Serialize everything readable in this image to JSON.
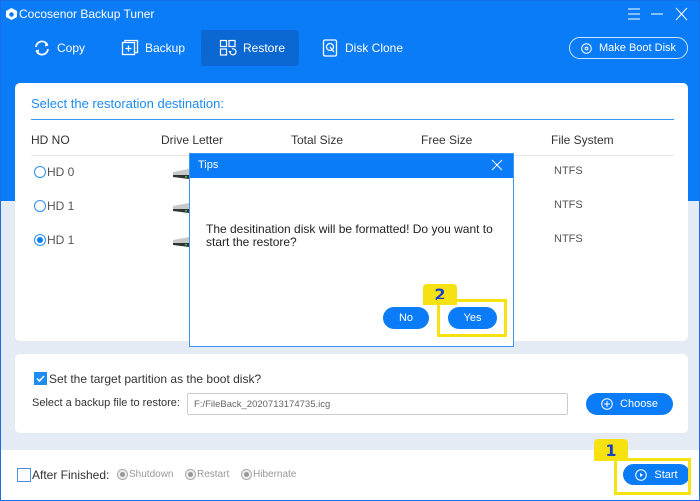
{
  "app": {
    "title": "Cocosenor Backup Tuner",
    "window_controls": [
      "menu",
      "minimize",
      "close"
    ]
  },
  "nav": {
    "items": [
      {
        "label": "Copy",
        "icon": "sync-icon",
        "active": false
      },
      {
        "label": "Backup",
        "icon": "backup-icon",
        "active": false
      },
      {
        "label": "Restore",
        "icon": "restore-icon",
        "active": true
      },
      {
        "label": "Disk Clone",
        "icon": "disk-clone-icon",
        "active": false
      }
    ],
    "make_boot_disk_label": "Make Boot Disk"
  },
  "destination": {
    "title": "Select the restoration destination:",
    "columns": [
      "HD NO",
      "Drive Letter",
      "Total Size",
      "Free Size",
      "File System"
    ],
    "rows": [
      {
        "hd": "HD 0",
        "drive_letter": "",
        "total_size": "",
        "free_size": "",
        "file_system": "NTFS",
        "selected": false
      },
      {
        "hd": "HD 1",
        "drive_letter": "",
        "total_size": "",
        "free_size": "",
        "file_system": "NTFS",
        "selected": false
      },
      {
        "hd": "HD 1",
        "drive_letter": "",
        "total_size": "",
        "free_size": "",
        "file_system": "NTFS",
        "selected": true
      }
    ]
  },
  "options": {
    "boot_disk_label": "Set the target partition as the boot disk?",
    "boot_disk_checked": true,
    "file_label": "Select a backup file to restore:",
    "file_value": "F:/FileBack_2020713174735.icg",
    "choose_label": "Choose"
  },
  "footer": {
    "after_finished_label": "After Finished:",
    "after_finished_checked": false,
    "choices": [
      "Shutdown",
      "Restart",
      "Hibernate"
    ],
    "start_label": "Start"
  },
  "dialog": {
    "title": "Tips",
    "message": "The desitination disk will be formatted! Do you want to start the restore?",
    "no_label": "No",
    "yes_label": "Yes"
  },
  "annotations": [
    {
      "number": "1",
      "target": "start-button"
    },
    {
      "number": "2",
      "target": "yes-button"
    }
  ],
  "colors": {
    "brand_blue": "#0a7cf7",
    "active_tab": "#0b68d2",
    "highlight_yellow": "#f7e211",
    "background": "#e4ebf5"
  }
}
